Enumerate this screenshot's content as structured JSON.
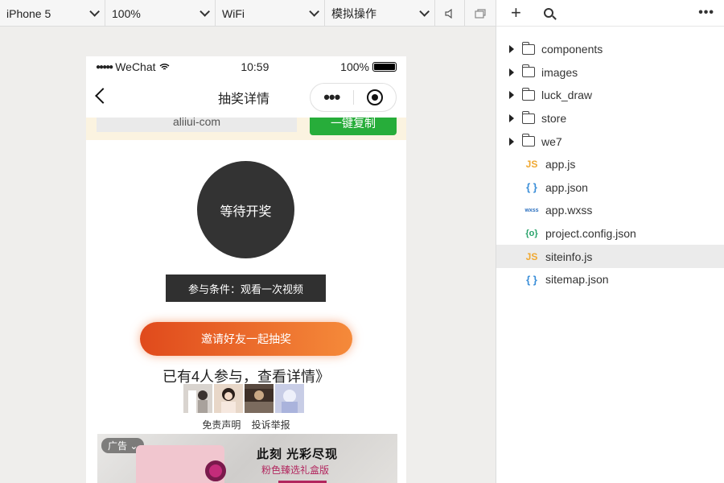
{
  "toolbar": {
    "device": "iPhone 5",
    "zoom": "100%",
    "network": "WiFi",
    "operation": "模拟操作"
  },
  "statusbar": {
    "carrier": "WeChat",
    "time": "10:59",
    "battery": "100%"
  },
  "navbar": {
    "title": "抽奖详情",
    "more": "•••"
  },
  "copybar": {
    "field_text": "aliiui-com",
    "button_label": "一键复制"
  },
  "lottery": {
    "status": "等待开奖",
    "condition": "参与条件：观看一次视频",
    "invite_label": "邀请好友一起抽奖",
    "joined_text": "已有4人参与，查看详情》",
    "disclaimer": "免责声明",
    "report": "投诉举报"
  },
  "ad": {
    "badge": "广告",
    "title": "此刻 光彩尽现",
    "subtitle": "粉色臻选礼盒版"
  },
  "explorer": {
    "items": [
      {
        "type": "folder",
        "name": "components"
      },
      {
        "type": "folder",
        "name": "images"
      },
      {
        "type": "folder",
        "name": "luck_draw"
      },
      {
        "type": "folder",
        "name": "store"
      },
      {
        "type": "folder",
        "name": "we7"
      },
      {
        "type": "file",
        "icon": "JS",
        "name": "app.js"
      },
      {
        "type": "file",
        "icon": "{ }",
        "name": "app.json"
      },
      {
        "type": "file",
        "icon": "wxss",
        "name": "app.wxss"
      },
      {
        "type": "file",
        "icon": "{o}",
        "name": "project.config.json"
      },
      {
        "type": "file",
        "icon": "JS",
        "name": "siteinfo.js",
        "selected": true
      },
      {
        "type": "file",
        "icon": "{ }",
        "name": "sitemap.json"
      }
    ]
  }
}
